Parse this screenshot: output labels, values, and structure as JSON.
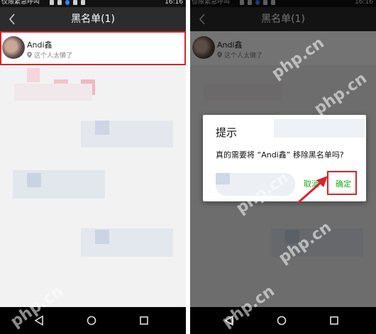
{
  "status_bar": {
    "carrier": "仅限紧急呼叫",
    "time": "16:16"
  },
  "header": {
    "title": "黑名单(1)"
  },
  "blacklist": {
    "items": [
      {
        "name": "Andi鑫",
        "signature": "这个人太懒了"
      }
    ]
  },
  "dialog": {
    "title": "提示",
    "message": "真的需要将 “Andi鑫” 移除黑名单吗?",
    "cancel_label": "取消",
    "confirm_label": "确定"
  },
  "watermark": "php.cn",
  "colors": {
    "highlight": "#d8232a",
    "accent_green": "#1aad19",
    "title_bar": "#2c2c2c",
    "nav_bar": "#000000"
  },
  "icons": {
    "back": "chevron-left-icon",
    "location": "location-pin-icon",
    "nav_back": "triangle-back-icon",
    "nav_home": "circle-home-icon",
    "nav_recent": "square-recent-icon"
  }
}
